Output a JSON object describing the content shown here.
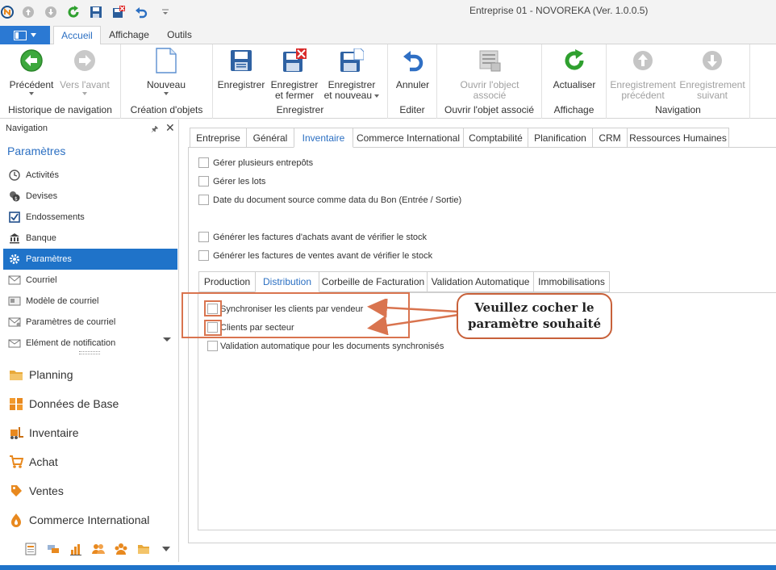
{
  "window": {
    "title": "Entreprise 01 - NOVOREKA (Ver. 1.0.0.5)"
  },
  "ribbon_tabs": [
    {
      "label": "Accueil",
      "active": true
    },
    {
      "label": "Affichage",
      "active": false
    },
    {
      "label": "Outils",
      "active": false
    }
  ],
  "ribbon": {
    "groups": {
      "historique": "Historique de navigation",
      "creation": "Création d'objets",
      "enregistrer": "Enregistrer",
      "editer": "Editer",
      "ouvrir": "Ouvrir l'objet associé",
      "affichage": "Affichage",
      "navigation": "Navigation"
    },
    "buttons": {
      "precedent": "Précédent",
      "vers_avant": "Vers l'avant",
      "nouveau": "Nouveau",
      "enregistrer": "Enregistrer",
      "enregistrer_fermer_1": "Enregistrer",
      "enregistrer_fermer_2": "et fermer",
      "enregistrer_nouveau_1": "Enregistrer",
      "enregistrer_nouveau_2": "et nouveau",
      "annuler": "Annuler",
      "ouvrir_objet_1": "Ouvrir l'object",
      "ouvrir_objet_2": "associé",
      "actualiser": "Actualiser",
      "enreg_precedent_1": "Enregistrement",
      "enreg_precedent_2": "précédent",
      "enreg_suivant_1": "Enregistrement",
      "enreg_suivant_2": "suivant"
    }
  },
  "nav": {
    "header": "Navigation",
    "section_title": "Paramètres",
    "items": [
      {
        "label": "Activités",
        "icon": "clock-icon"
      },
      {
        "label": "Devises",
        "icon": "coins-icon"
      },
      {
        "label": "Endossements",
        "icon": "checkbox-icon"
      },
      {
        "label": "Banque",
        "icon": "bank-icon"
      },
      {
        "label": "Paramètres",
        "icon": "gear-icon",
        "selected": true
      },
      {
        "label": "Courriel",
        "icon": "envelope-icon"
      },
      {
        "label": "Modèle de courriel",
        "icon": "email-template-icon"
      },
      {
        "label": "Paramètres de courriel",
        "icon": "email-settings-icon"
      },
      {
        "label": "Elément de notification",
        "icon": "notification-icon"
      }
    ],
    "modules": [
      {
        "label": "Planning",
        "icon": "folder-icon"
      },
      {
        "label": "Données de Base",
        "icon": "database-icon"
      },
      {
        "label": "Inventaire",
        "icon": "forklift-icon"
      },
      {
        "label": "Achat",
        "icon": "cart-icon"
      },
      {
        "label": "Ventes",
        "icon": "sales-icon"
      },
      {
        "label": "Commerce International",
        "icon": "international-icon"
      }
    ]
  },
  "content": {
    "tabs": [
      {
        "label": "Entreprise"
      },
      {
        "label": "Général"
      },
      {
        "label": "Inventaire",
        "active": true
      },
      {
        "label": "Commerce International"
      },
      {
        "label": "Comptabilité"
      },
      {
        "label": "Planification"
      },
      {
        "label": "CRM"
      },
      {
        "label": "Ressources Humaines"
      }
    ],
    "options": [
      {
        "label": "Gérer plusieurs entrepôts",
        "checked": false
      },
      {
        "label": "Gérer les lots",
        "checked": false
      },
      {
        "label": "Date du document source comme data du Bon (Entrée / Sortie)",
        "checked": false
      },
      {
        "label": "Générer les factures d'achats avant de vérifier le stock",
        "checked": false
      },
      {
        "label": "Générer les factures de ventes avant de vérifier le stock",
        "checked": false
      }
    ],
    "sub_tabs": [
      {
        "label": "Production"
      },
      {
        "label": "Distribution",
        "active": true
      },
      {
        "label": "Corbeille de Facturation"
      },
      {
        "label": "Validation Automatique"
      },
      {
        "label": "Immobilisations"
      }
    ],
    "distribution_options": [
      {
        "label": "Synchroniser les clients par vendeur",
        "checked": false
      },
      {
        "label": "Clients par secteur",
        "checked": false
      },
      {
        "label": "Validation automatique pour les documents synchronisés",
        "checked": false
      }
    ]
  },
  "annotation": {
    "line1": "Veuillez cocher le",
    "line2": "paramètre souhaité",
    "color": "#d9744f"
  },
  "colors": {
    "accent": "#2b6fc2",
    "selection": "#1f73c9",
    "ribbon_bg": "#f3f3f3"
  }
}
